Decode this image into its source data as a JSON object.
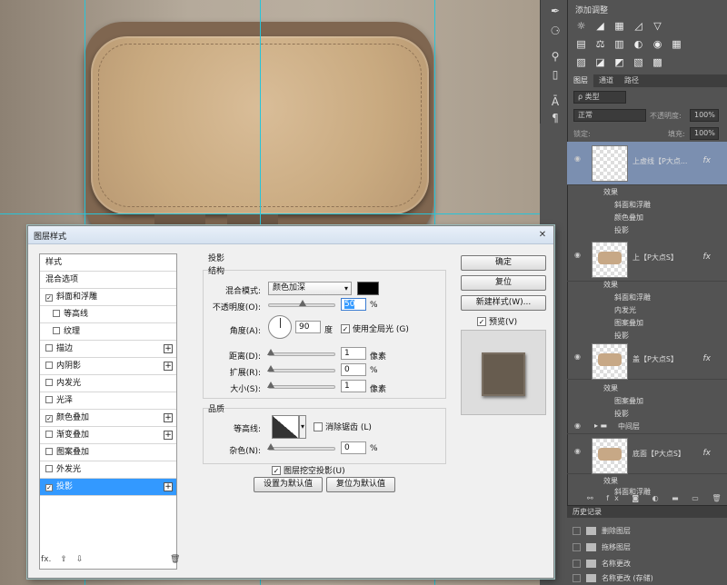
{
  "toolbar_tools": [
    "pen-icon",
    "type-icon",
    "path-select-icon",
    "shape-icon",
    "hand-icon",
    "zoom-icon",
    "text-vertical-icon",
    "paragraph-icon"
  ],
  "adjustments": {
    "title": "添加调整",
    "row1": [
      "☼",
      "◢",
      "▦",
      "◿",
      "▽"
    ],
    "row2": [
      "▤",
      "⚖",
      "▥",
      "◐",
      "◉",
      "▦"
    ],
    "row3": [
      "▨",
      "◪",
      "◩",
      "▧",
      "▩"
    ]
  },
  "layers_panel": {
    "tabs": [
      "图层",
      "通道",
      "路径"
    ],
    "filter_label": "ρ 类型",
    "blend_mode": "正常",
    "opacity_label": "不透明度:",
    "opacity_value": "100%",
    "lock_label": "锁定:",
    "fill_label": "填充:",
    "fill_value": "100%",
    "fx_label": "fx",
    "layers": [
      {
        "name": "上虚线【P大点...",
        "effects": [
          "效果",
          "斜面和浮雕",
          "颜色叠加",
          "投影"
        ]
      },
      {
        "name": "上【P大点S】",
        "effects": [
          "效果",
          "斜面和浮雕",
          "内发光",
          "图案叠加",
          "投影"
        ]
      },
      {
        "name": "盖【P大点S】",
        "effects": [
          "效果",
          "图案叠加",
          "投影"
        ]
      },
      {
        "name": "中间层"
      },
      {
        "name": "底面【P大点S】",
        "effects": [
          "效果",
          "斜面和浮雕"
        ]
      }
    ],
    "bottom_icons": "⚯ fx ◙ ◐ ▬ ▭ 🗑"
  },
  "history_panel": {
    "title": "历史记录",
    "items": [
      "删除图层",
      "拖移图层",
      "名称更改",
      "名称更改 (存储)"
    ]
  },
  "dialog": {
    "title": "图层样式",
    "close": "✕",
    "styles_list": [
      {
        "label": "样式",
        "checkbox": false,
        "checked": false,
        "plus": false
      },
      {
        "label": "混合选项",
        "checkbox": false,
        "checked": false,
        "plus": false
      },
      {
        "label": "斜面和浮雕",
        "checkbox": true,
        "checked": true,
        "plus": false
      },
      {
        "label": "等高线",
        "checkbox": true,
        "checked": false,
        "plus": false,
        "indent": true
      },
      {
        "label": "纹理",
        "checkbox": true,
        "checked": false,
        "plus": false,
        "indent": true
      },
      {
        "label": "描边",
        "checkbox": true,
        "checked": false,
        "plus": true
      },
      {
        "label": "内阴影",
        "checkbox": true,
        "checked": false,
        "plus": true
      },
      {
        "label": "内发光",
        "checkbox": true,
        "checked": false,
        "plus": false
      },
      {
        "label": "光泽",
        "checkbox": true,
        "checked": false,
        "plus": false
      },
      {
        "label": "颜色叠加",
        "checkbox": true,
        "checked": true,
        "plus": true
      },
      {
        "label": "渐变叠加",
        "checkbox": true,
        "checked": false,
        "plus": true
      },
      {
        "label": "图案叠加",
        "checkbox": true,
        "checked": false,
        "plus": false
      },
      {
        "label": "外发光",
        "checkbox": true,
        "checked": false,
        "plus": false
      },
      {
        "label": "投影",
        "checkbox": true,
        "checked": true,
        "plus": true,
        "selected": true
      }
    ],
    "footer": {
      "fx": "fx.",
      "up": "⇧",
      "down": "⇩",
      "trash": "🗑"
    },
    "drop_shadow": {
      "heading": "投影",
      "structure_heading": "结构",
      "blend_mode_label": "混合模式:",
      "blend_mode_value": "颜色加深",
      "opacity_label": "不透明度(O):",
      "opacity_value": "50",
      "opacity_fraction": 0.5,
      "percent": "%",
      "angle_label": "角度(A):",
      "angle_value": "90",
      "angle_unit": "度",
      "global_light_label": "使用全局光 (G)",
      "distance_label": "距离(D):",
      "distance_value": "1",
      "distance_fraction": 0.0,
      "pixel_unit": "像素",
      "spread_label": "扩展(R):",
      "spread_value": "0",
      "size_label": "大小(S):",
      "size_value": "1",
      "quality_heading": "品质",
      "contour_label": "等高线:",
      "antialias_label": "消除锯齿 (L)",
      "noise_label": "杂色(N):",
      "noise_value": "0",
      "knockout_label": "图层挖空投影(U)",
      "make_default": "设置为默认值",
      "reset_default": "复位为默认值"
    },
    "buttons": {
      "ok": "确定",
      "reset": "复位",
      "new_style": "新建样式(W)...",
      "preview_label": "预览(V)"
    }
  }
}
